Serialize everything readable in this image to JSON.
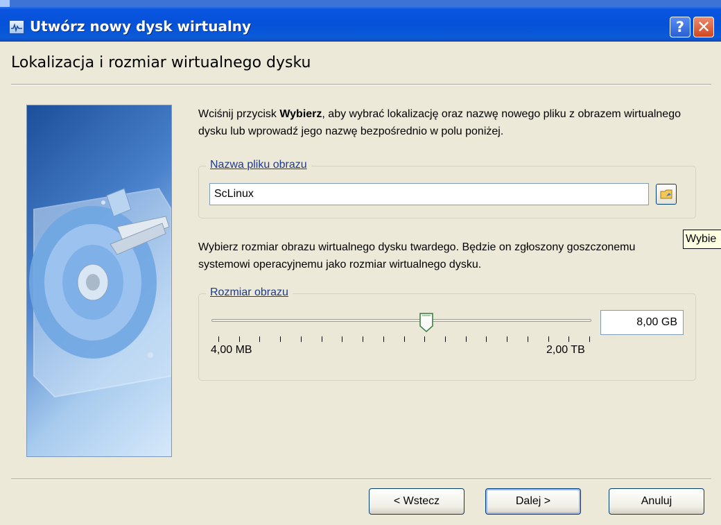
{
  "window": {
    "title": "Utwórz nowy dysk wirtualny",
    "help_glyph": "?",
    "close_glyph": "✕"
  },
  "header": {
    "title": "Lokalizacja i rozmiar wirtualnego dysku"
  },
  "intro": {
    "text_before": "Wciśnij przycisk ",
    "text_bold": "Wybierz",
    "text_after": ", aby wybrać lokalizację oraz nazwę nowego pliku z obrazem wirtualnego dysku lub wprowadź jego nazwę bezpośrednio w polu poniżej."
  },
  "file_group": {
    "legend": "Nazwa pliku obrazu",
    "value": "ScLinux"
  },
  "tooltip": {
    "text": "Wybie"
  },
  "size_description": "Wybierz rozmiar obrazu wirtualnego dysku twardego. Będzie on zgłoszony goszczonemu systemowi operacyjnemu jako rozmiar wirtualnego dysku.",
  "size_group": {
    "legend": "Rozmiar obrazu",
    "min_label": "4,00 MB",
    "max_label": "2,00 TB",
    "value": "8,00 GB",
    "slider_position": 0.57
  },
  "buttons": {
    "back": "< Wstecz",
    "next": "Dalej >",
    "cancel": "Anuluj"
  },
  "colors": {
    "titlebar": "#0551d8",
    "dialog_bg": "#ece9d8",
    "accent_legend": "#1e3a8a"
  },
  "icons": {
    "app": "virtual-disk-app-icon",
    "help": "help-icon",
    "close": "close-icon",
    "browse": "folder-browse-icon",
    "art": "hard-disk-illustration"
  }
}
